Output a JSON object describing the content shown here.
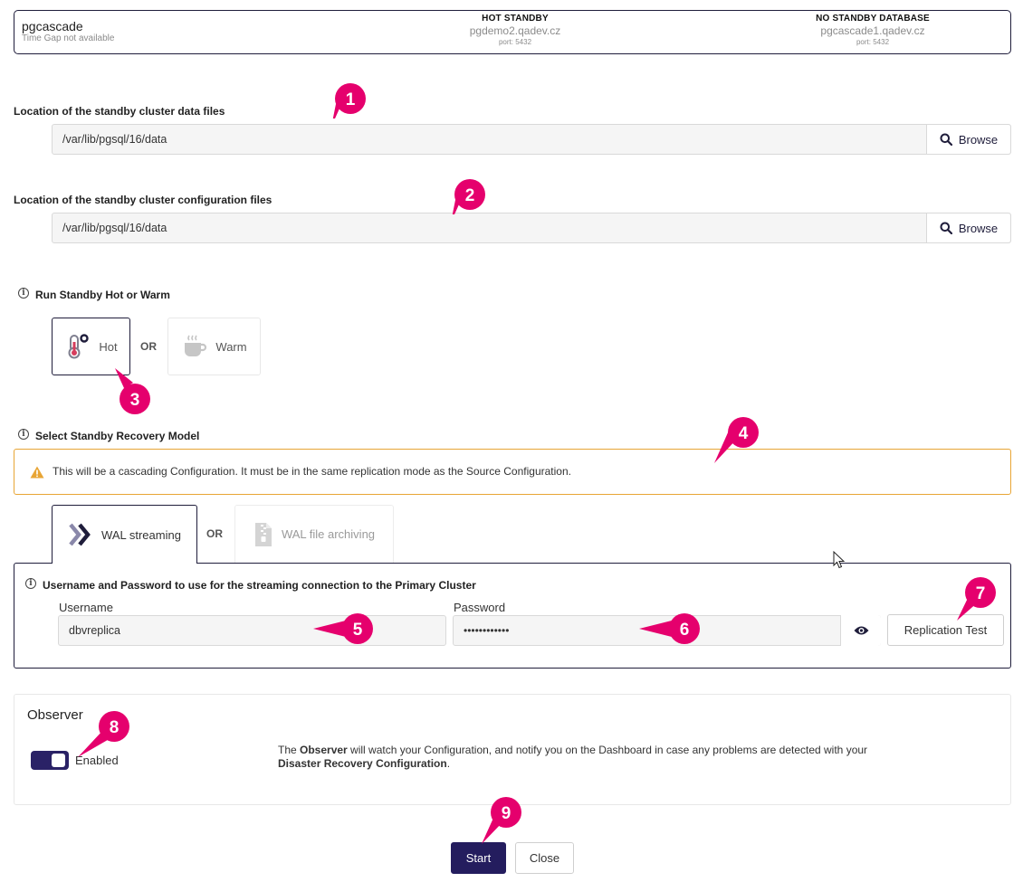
{
  "header": {
    "config_name": "pgcascade",
    "time_gap": "Time Gap not available",
    "standby": {
      "heading": "HOT STANDBY",
      "host": "pgdemo2.qadev.cz",
      "port": "port: 5432"
    },
    "target": {
      "heading": "NO STANDBY DATABASE",
      "host": "pgcascade1.qadev.cz",
      "port": "port: 5432"
    }
  },
  "data_files": {
    "label": "Location of the standby cluster data files",
    "value": "/var/lib/pgsql/16/data",
    "browse_label": "Browse"
  },
  "config_files": {
    "label": "Location of the standby cluster configuration files",
    "value": "/var/lib/pgsql/16/data",
    "browse_label": "Browse"
  },
  "run_mode": {
    "label": "Run Standby Hot or Warm",
    "options": [
      {
        "label": "Hot",
        "selected": true
      },
      {
        "label": "Warm",
        "selected": false
      }
    ],
    "or_text": "OR"
  },
  "recovery_model": {
    "label": "Select Standby Recovery Model",
    "warning": "This will be a cascading Configuration. It must be in the same replication mode as the Source Configuration.",
    "tabs": [
      {
        "label": "WAL streaming",
        "selected": true
      },
      {
        "label": "WAL file archiving",
        "selected": false
      }
    ],
    "or_text": "OR"
  },
  "streaming": {
    "heading": "Username and Password to use for the streaming connection to the Primary Cluster",
    "username_label": "Username",
    "username_value": "dbvreplica",
    "password_label": "Password",
    "password_value": "••••••••••••",
    "replication_test_label": "Replication Test"
  },
  "observer": {
    "title": "Observer",
    "toggle_label": "Enabled",
    "enabled": true,
    "desc_prefix": "The ",
    "desc_bold1": "Observer",
    "desc_mid": " will watch your Configuration, and notify you on the Dashboard in case any problems are detected with your ",
    "desc_bold2": "Disaster Recovery Configuration",
    "desc_suffix": "."
  },
  "actions": {
    "start_label": "Start",
    "close_label": "Close"
  },
  "markers": [
    "1",
    "2",
    "3",
    "4",
    "5",
    "6",
    "7",
    "8",
    "9"
  ],
  "colors": {
    "accent": "#241d5e",
    "marker": "#e5006d",
    "warning": "#e8a535"
  }
}
